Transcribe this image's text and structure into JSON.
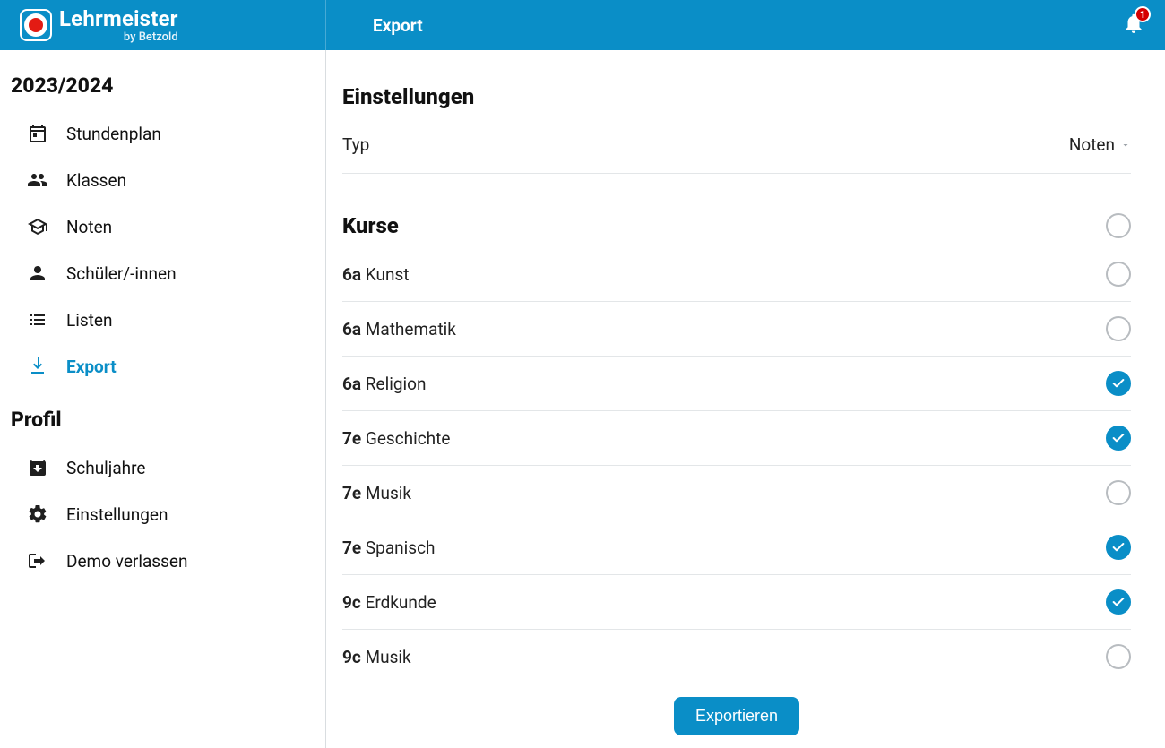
{
  "brand": {
    "title": "Lehrmeister",
    "subtitle": "by Betzold"
  },
  "header": {
    "page_title": "Export",
    "notification_count": "1"
  },
  "sidebar": {
    "section1_title": "2023/2024",
    "items1": [
      {
        "label": "Stundenplan",
        "icon": "calendar"
      },
      {
        "label": "Klassen",
        "icon": "group"
      },
      {
        "label": "Noten",
        "icon": "school"
      },
      {
        "label": "Schüler/-innen",
        "icon": "person"
      },
      {
        "label": "Listen",
        "icon": "list"
      },
      {
        "label": "Export",
        "icon": "download",
        "active": true
      }
    ],
    "section2_title": "Profil",
    "items2": [
      {
        "label": "Schuljahre",
        "icon": "archive"
      },
      {
        "label": "Einstellungen",
        "icon": "settings"
      },
      {
        "label": "Demo verlassen",
        "icon": "exit"
      }
    ]
  },
  "content": {
    "settings_title": "Einstellungen",
    "typ_label": "Typ",
    "typ_value": "Noten",
    "courses_title": "Kurse",
    "select_all_checked": false,
    "courses": [
      {
        "klass": "6a",
        "subject": "Kunst",
        "checked": false
      },
      {
        "klass": "6a",
        "subject": "Mathematik",
        "checked": false
      },
      {
        "klass": "6a",
        "subject": "Religion",
        "checked": true
      },
      {
        "klass": "7e",
        "subject": "Geschichte",
        "checked": true
      },
      {
        "klass": "7e",
        "subject": "Musik",
        "checked": false
      },
      {
        "klass": "7e",
        "subject": "Spanisch",
        "checked": true
      },
      {
        "klass": "9c",
        "subject": "Erdkunde",
        "checked": true
      },
      {
        "klass": "9c",
        "subject": "Musik",
        "checked": false
      }
    ],
    "export_button": "Exportieren"
  }
}
